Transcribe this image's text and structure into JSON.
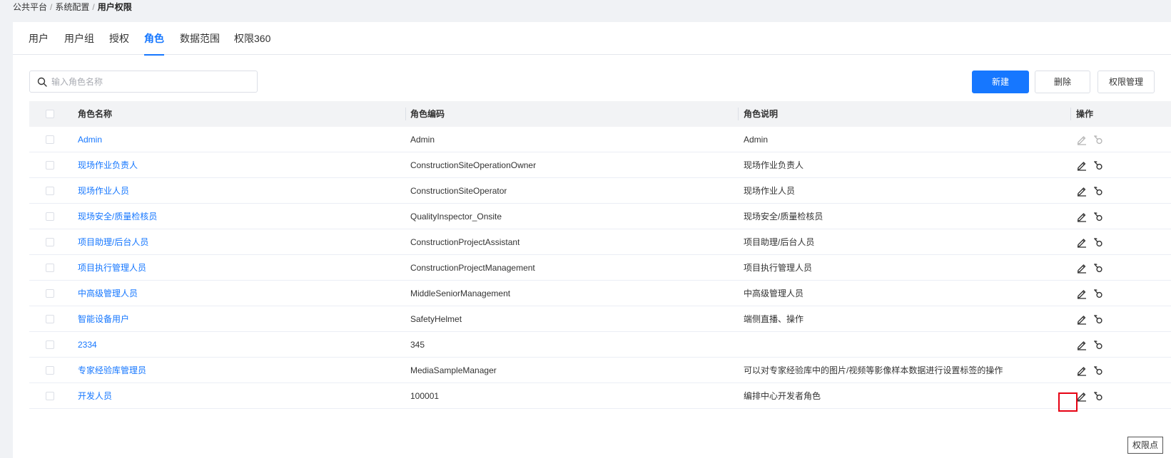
{
  "breadcrumb": {
    "items": [
      "公共平台",
      "系统配置"
    ],
    "current": "用户权限",
    "separator": "/"
  },
  "tabs": [
    {
      "label": "用户",
      "active": false
    },
    {
      "label": "用户组",
      "active": false
    },
    {
      "label": "授权",
      "active": false
    },
    {
      "label": "角色",
      "active": true
    },
    {
      "label": "数据范围",
      "active": false
    },
    {
      "label": "权限360",
      "active": false
    }
  ],
  "search": {
    "placeholder": "输入角色名称",
    "value": ""
  },
  "toolbar": {
    "new_label": "新建",
    "delete_label": "删除",
    "perm_manage_label": "权限管理"
  },
  "table": {
    "columns": {
      "name": "角色名称",
      "code": "角色编码",
      "desc": "角色说明",
      "op": "操作"
    },
    "rows": [
      {
        "name": "Admin",
        "code": "Admin",
        "desc": "Admin",
        "disabled": true
      },
      {
        "name": "现场作业负责人",
        "code": "ConstructionSiteOperationOwner",
        "desc": "现场作业负责人",
        "disabled": false
      },
      {
        "name": "现场作业人员",
        "code": "ConstructionSiteOperator",
        "desc": "现场作业人员",
        "disabled": false
      },
      {
        "name": "现场安全/质量检核员",
        "code": "QualityInspector_Onsite",
        "desc": "现场安全/质量检核员",
        "disabled": false
      },
      {
        "name": "项目助理/后台人员",
        "code": "ConstructionProjectAssistant",
        "desc": "项目助理/后台人员",
        "disabled": false
      },
      {
        "name": "项目执行管理人员",
        "code": "ConstructionProjectManagement",
        "desc": "项目执行管理人员",
        "disabled": false
      },
      {
        "name": "中高级管理人员",
        "code": "MiddleSeniorManagement",
        "desc": "中高级管理人员",
        "disabled": false
      },
      {
        "name": "智能设备用户",
        "code": "SafetyHelmet",
        "desc": "端侧直播、操作",
        "disabled": false
      },
      {
        "name": "2334",
        "code": "345",
        "desc": "",
        "disabled": false
      },
      {
        "name": "专家经验库管理员",
        "code": "MediaSampleManager",
        "desc": "可以对专家经验库中的图片/视频等影像样本数据进行设置标签的操作",
        "disabled": false
      },
      {
        "name": "开发人员",
        "code": "100001",
        "desc": "编排中心开发者角色",
        "disabled": false
      }
    ]
  },
  "tooltip": {
    "label": "权限点"
  },
  "icons": {
    "search": "search-icon",
    "edit": "edit-icon",
    "permission": "permission-point-icon"
  },
  "colors": {
    "primary": "#1677ff",
    "highlight": "#e60012"
  }
}
